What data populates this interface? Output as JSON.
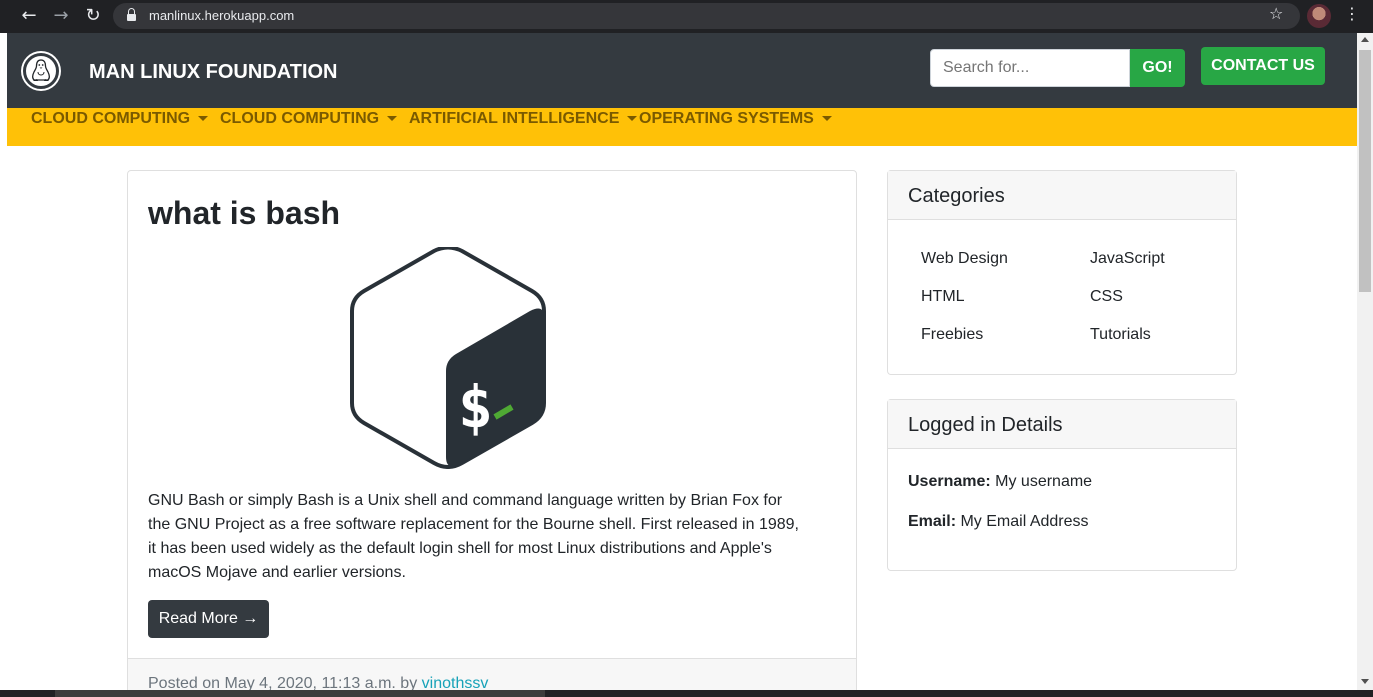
{
  "browser": {
    "url": "manlinux.herokuapp.com",
    "back_icon": "arrow-left-icon",
    "forward_icon": "arrow-right-icon",
    "reload_icon": "reload-icon",
    "bookmark_icon": "star-icon",
    "menu_icon": "kebab-menu-icon"
  },
  "header": {
    "brand": "MAN LINUX FOUNDATION",
    "logo_icon": "linux-tux-icon",
    "search_placeholder": "Search for...",
    "search_button": "GO!",
    "contact_button": "CONTACT US"
  },
  "menu": {
    "items": [
      {
        "label": "CLOUD COMPUTING"
      },
      {
        "label": "CLOUD COMPUTING"
      },
      {
        "label": "ARTIFICIAL INTELLIGENCE"
      },
      {
        "label": "OPERATING SYSTEMS"
      }
    ]
  },
  "post": {
    "title": "what is bash",
    "image_icon": "bash-logo-icon",
    "body": "GNU Bash or simply Bash is a Unix shell and command language written by Brian Fox for the GNU Project as a free software replacement for the Bourne shell. First released in 1989, it has been used widely as the default login shell for most Linux distributions and Apple's macOS Mojave and earlier versions.",
    "read_more": "Read More →",
    "posted_prefix": "Posted on May 4, 2020, 11:13 a.m. by",
    "author": "vinothssv"
  },
  "categories": {
    "title": "Categories",
    "items": [
      "Web Design",
      "JavaScript",
      "HTML",
      "CSS",
      "Freebies",
      "Tutorials"
    ]
  },
  "logged_in": {
    "title": "Logged in Details",
    "username_label": "Username:",
    "username_value": "My username",
    "email_label": "Email:",
    "email_value": "My Email Address"
  },
  "colors": {
    "header_bg": "#343a40",
    "menubar_bg": "#ffc107",
    "success": "#28a745",
    "link": "#17a2b8"
  }
}
